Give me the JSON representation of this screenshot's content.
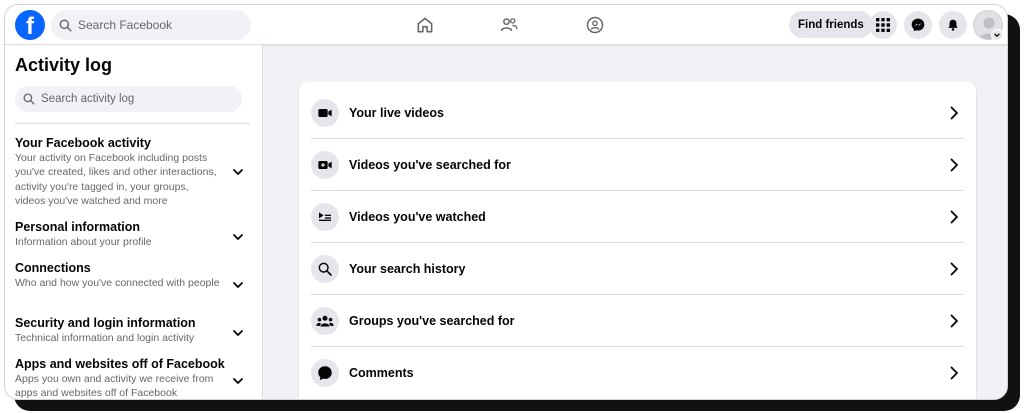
{
  "topbar": {
    "logo_letter": "f",
    "search_placeholder": "Search Facebook",
    "find_friends_label": "Find friends",
    "nav_icons": [
      "home-icon",
      "friends-icon",
      "groups-icon"
    ],
    "action_icons": [
      "menu-grid-icon",
      "messenger-icon",
      "notifications-bell-icon"
    ]
  },
  "sidebar": {
    "title": "Activity log",
    "search_placeholder": "Search activity log",
    "sections": [
      {
        "title": "Your Facebook activity",
        "desc": "Your activity on Facebook including posts you've created, likes and other interactions, activity you're tagged in, your groups, videos you've watched and more"
      },
      {
        "title": "Personal information",
        "desc": "Information about your profile"
      },
      {
        "title": "Connections",
        "desc": "Who and how you've connected with people"
      },
      {
        "title": "Security and login information",
        "desc": "Technical information and login activity"
      },
      {
        "title": "Apps and websites off of Facebook",
        "desc": "Apps you own and activity we receive from apps and websites off of Facebook"
      }
    ]
  },
  "main": {
    "items": [
      {
        "label": "Your live videos",
        "icon": "live-video-icon"
      },
      {
        "label": "Videos you've searched for",
        "icon": "video-search-icon"
      },
      {
        "label": "Videos you've watched",
        "icon": "video-playlist-icon"
      },
      {
        "label": "Your search history",
        "icon": "search-icon"
      },
      {
        "label": "Groups you've searched for",
        "icon": "groups-icon"
      },
      {
        "label": "Comments",
        "icon": "comment-icon"
      }
    ]
  },
  "colors": {
    "brand": "#0866ff",
    "background": "#f0f2f5",
    "text_primary": "#050505",
    "text_secondary": "#65676b"
  }
}
